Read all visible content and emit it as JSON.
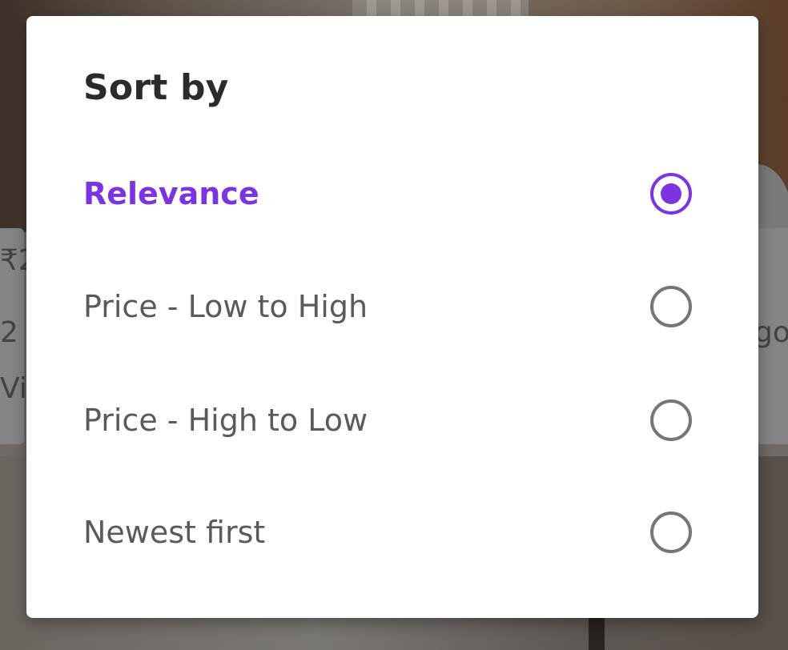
{
  "background": {
    "card_left_price": "₹2",
    "card_left_line2": "2",
    "card_left_line3": "Vi",
    "card_right_text": "go"
  },
  "dialog": {
    "title": "Sort by",
    "accent_color": "#7b34e0",
    "options": [
      {
        "label": "Relevance",
        "selected": true,
        "icon": "radio-selected-icon"
      },
      {
        "label": "Price - Low to High",
        "selected": false,
        "icon": "radio-unselected-icon"
      },
      {
        "label": "Price - High to Low",
        "selected": false,
        "icon": "radio-unselected-icon"
      },
      {
        "label": "Newest first",
        "selected": false,
        "icon": "radio-unselected-icon"
      }
    ]
  }
}
